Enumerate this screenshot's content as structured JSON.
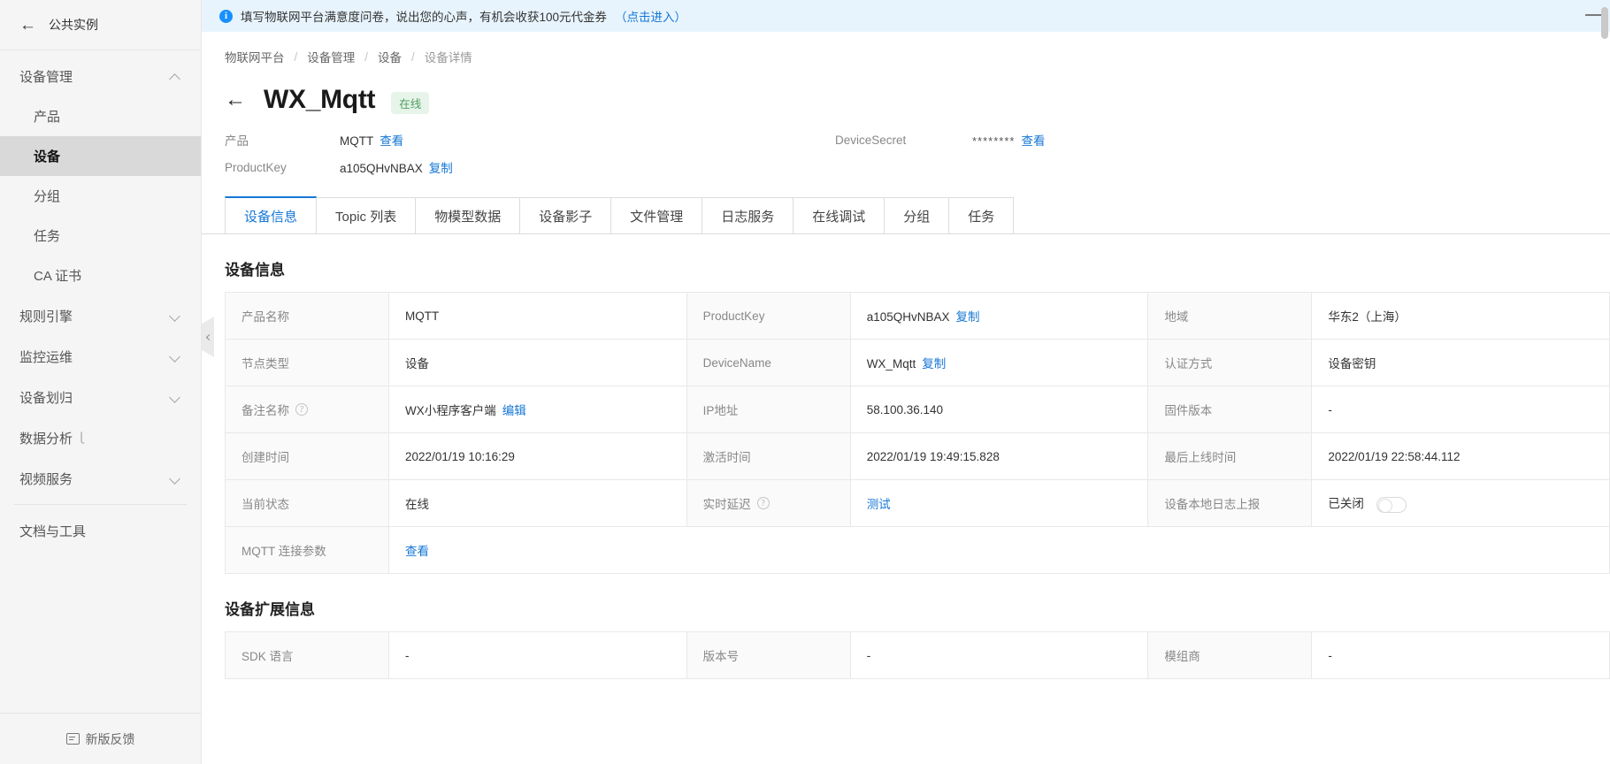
{
  "sidebar": {
    "back_label": "公共实例",
    "back_icon": "arrow-left-icon",
    "groups": [
      {
        "label": "设备管理",
        "expanded": true,
        "items": [
          {
            "label": "产品",
            "active": false
          },
          {
            "label": "设备",
            "active": true
          },
          {
            "label": "分组",
            "active": false
          },
          {
            "label": "任务",
            "active": false
          },
          {
            "label": "CA 证书",
            "active": false
          }
        ]
      },
      {
        "label": "规则引擎",
        "expanded": false,
        "items": []
      },
      {
        "label": "监控运维",
        "expanded": false,
        "items": []
      },
      {
        "label": "设备划归",
        "expanded": false,
        "items": []
      },
      {
        "label": "数据分析",
        "expanded": false,
        "external": true,
        "items": []
      },
      {
        "label": "视频服务",
        "expanded": false,
        "items": []
      }
    ],
    "standalone": {
      "label": "文档与工具"
    },
    "footer": {
      "label": "新版反馈",
      "icon": "feedback-icon"
    }
  },
  "notice": {
    "icon": "info-circle-icon",
    "text": "填写物联网平台满意度问卷，说出您的心声，有机会收获100元代金券",
    "link": "（点击进入）",
    "close_icon": "close-icon"
  },
  "breadcrumb": {
    "items": [
      "物联网平台",
      "设备管理",
      "设备",
      "设备详情"
    ],
    "separator": "/"
  },
  "page": {
    "back_icon": "arrow-left-icon",
    "title": "WX_Mqtt",
    "status_badge": "在线",
    "meta": {
      "product_label": "产品",
      "product_value": "MQTT",
      "product_link": "查看",
      "secret_label": "DeviceSecret",
      "secret_value": "********",
      "secret_link": "查看",
      "productkey_label": "ProductKey",
      "productkey_value": "a105QHvNBAX",
      "productkey_link": "复制"
    }
  },
  "tabs": [
    {
      "label": "设备信息",
      "active": true
    },
    {
      "label": "Topic 列表",
      "active": false
    },
    {
      "label": "物模型数据",
      "active": false
    },
    {
      "label": "设备影子",
      "active": false
    },
    {
      "label": "文件管理",
      "active": false
    },
    {
      "label": "日志服务",
      "active": false
    },
    {
      "label": "在线调试",
      "active": false
    },
    {
      "label": "分组",
      "active": false
    },
    {
      "label": "任务",
      "active": false
    }
  ],
  "device_info": {
    "section_title": "设备信息",
    "rows": [
      {
        "k1": "产品名称",
        "v1": "MQTT",
        "v1_link": "",
        "k2": "ProductKey",
        "v2": "a105QHvNBAX",
        "v2_link": "复制",
        "k3": "地域",
        "v3": "华东2（上海）",
        "v3_link": ""
      },
      {
        "k1": "节点类型",
        "v1": "设备",
        "v1_link": "",
        "k2": "DeviceName",
        "v2": "WX_Mqtt",
        "v2_link": "复制",
        "k3": "认证方式",
        "v3": "设备密钥",
        "v3_link": ""
      },
      {
        "k1": "备注名称",
        "k1_help": true,
        "v1": "WX小程序客户端",
        "v1_link": "编辑",
        "k2": "IP地址",
        "v2": "58.100.36.140",
        "v2_link": "",
        "k3": "固件版本",
        "v3": "-",
        "v3_link": ""
      },
      {
        "k1": "创建时间",
        "v1": "2022/01/19 10:16:29",
        "v1_link": "",
        "k2": "激活时间",
        "v2": "2022/01/19 19:49:15.828",
        "v2_link": "",
        "k3": "最后上线时间",
        "v3": "2022/01/19 22:58:44.112",
        "v3_link": ""
      },
      {
        "k1": "当前状态",
        "v1": "在线",
        "v1_link": "",
        "k2": "实时延迟",
        "k2_help": true,
        "v2": "",
        "v2_link": "测试",
        "k3": "设备本地日志上报",
        "v3": "已关闭",
        "v3_toggle": true,
        "v3_toggle_on": false
      }
    ],
    "last_row": {
      "k": "MQTT 连接参数",
      "v_link": "查看"
    }
  },
  "device_ext": {
    "section_title": "设备扩展信息",
    "rows": [
      {
        "k1": "SDK 语言",
        "v1": "-",
        "k2": "版本号",
        "v2": "-",
        "k3": "模组商",
        "v3": "-"
      }
    ]
  }
}
